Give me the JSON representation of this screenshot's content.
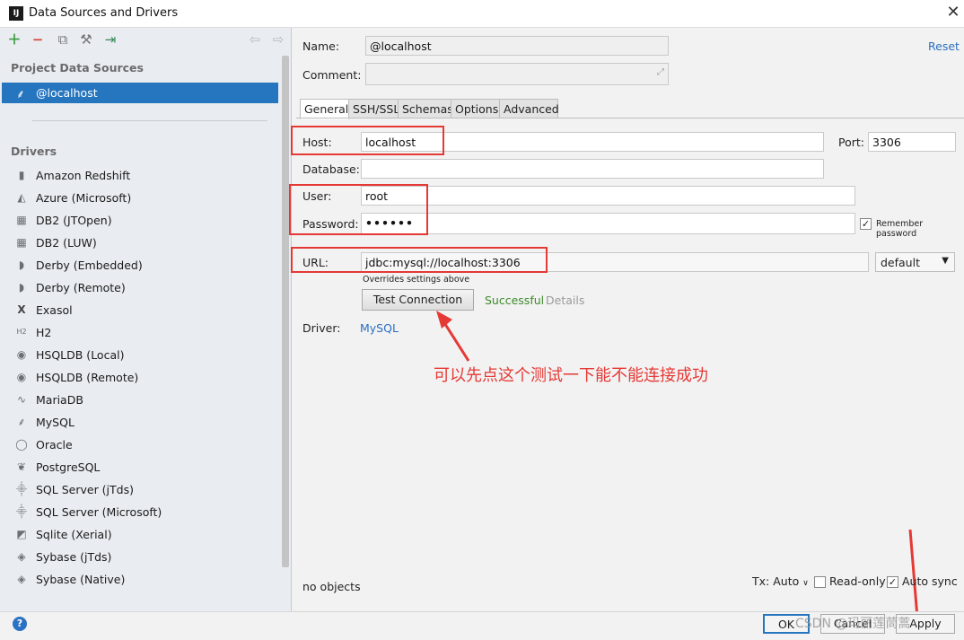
{
  "window": {
    "title": "Data Sources and Drivers",
    "app_icon": "IJ",
    "close_glyph": "✕"
  },
  "left": {
    "project_header": "Project Data Sources",
    "selected_source": "@localhost",
    "drivers_header": "Drivers",
    "drivers": [
      {
        "label": "Amazon Redshift",
        "icon": "bar-icon"
      },
      {
        "label": "Azure (Microsoft)",
        "icon": "azure-icon"
      },
      {
        "label": "DB2 (JTOpen)",
        "icon": "db2-icon"
      },
      {
        "label": "DB2 (LUW)",
        "icon": "db2-icon"
      },
      {
        "label": "Derby (Embedded)",
        "icon": "derby-icon"
      },
      {
        "label": "Derby (Remote)",
        "icon": "derby-icon"
      },
      {
        "label": "Exasol",
        "icon": "exasol-icon"
      },
      {
        "label": "H2",
        "icon": "h2-icon"
      },
      {
        "label": "HSQLDB (Local)",
        "icon": "hsqldb-icon"
      },
      {
        "label": "HSQLDB (Remote)",
        "icon": "hsqldb-icon"
      },
      {
        "label": "MariaDB",
        "icon": "mariadb-icon"
      },
      {
        "label": "MySQL",
        "icon": "mysql-icon"
      },
      {
        "label": "Oracle",
        "icon": "oracle-icon"
      },
      {
        "label": "PostgreSQL",
        "icon": "postgresql-icon"
      },
      {
        "label": "SQL Server (jTds)",
        "icon": "sqlserver-icon"
      },
      {
        "label": "SQL Server (Microsoft)",
        "icon": "sqlserver-icon"
      },
      {
        "label": "Sqlite (Xerial)",
        "icon": "sqlite-icon"
      },
      {
        "label": "Sybase (jTds)",
        "icon": "sybase-icon"
      },
      {
        "label": "Sybase (Native)",
        "icon": "sybase-icon"
      }
    ]
  },
  "form": {
    "name_label": "Name:",
    "name_value": "@localhost",
    "comment_label": "Comment:",
    "reset": "Reset",
    "tabs": [
      "General",
      "SSH/SSL",
      "Schemas",
      "Options",
      "Advanced"
    ],
    "host_label": "Host:",
    "host_value": "localhost",
    "port_label": "Port:",
    "port_value": "3306",
    "database_label": "Database:",
    "user_label": "User:",
    "user_value": "root",
    "password_label": "Password:",
    "password_value": "••••••",
    "remember_password": "Remember password",
    "url_label": "URL:",
    "url_value": "jdbc:mysql://localhost:3306",
    "url_mode": "default",
    "overrides_note": "Overrides settings above",
    "test_button": "Test Connection",
    "test_status": "Successful",
    "details": "Details",
    "driver_label": "Driver:",
    "driver_value": "MySQL"
  },
  "annotation": "可以先点这个测试一下能不能连接成功",
  "footer": {
    "objects": "no objects",
    "tx": "Tx: Auto",
    "read_only": "Read-only",
    "auto_sync": "Auto sync",
    "ok": "OK",
    "cancel": "Cancel",
    "apply": "Apply",
    "watermark": "CSDN @玛丽莲茼蒿"
  },
  "colors": {
    "selection": "#2675bf",
    "link": "#2b6fc0",
    "annotation": "#e53935",
    "success": "#3d8a2a"
  }
}
